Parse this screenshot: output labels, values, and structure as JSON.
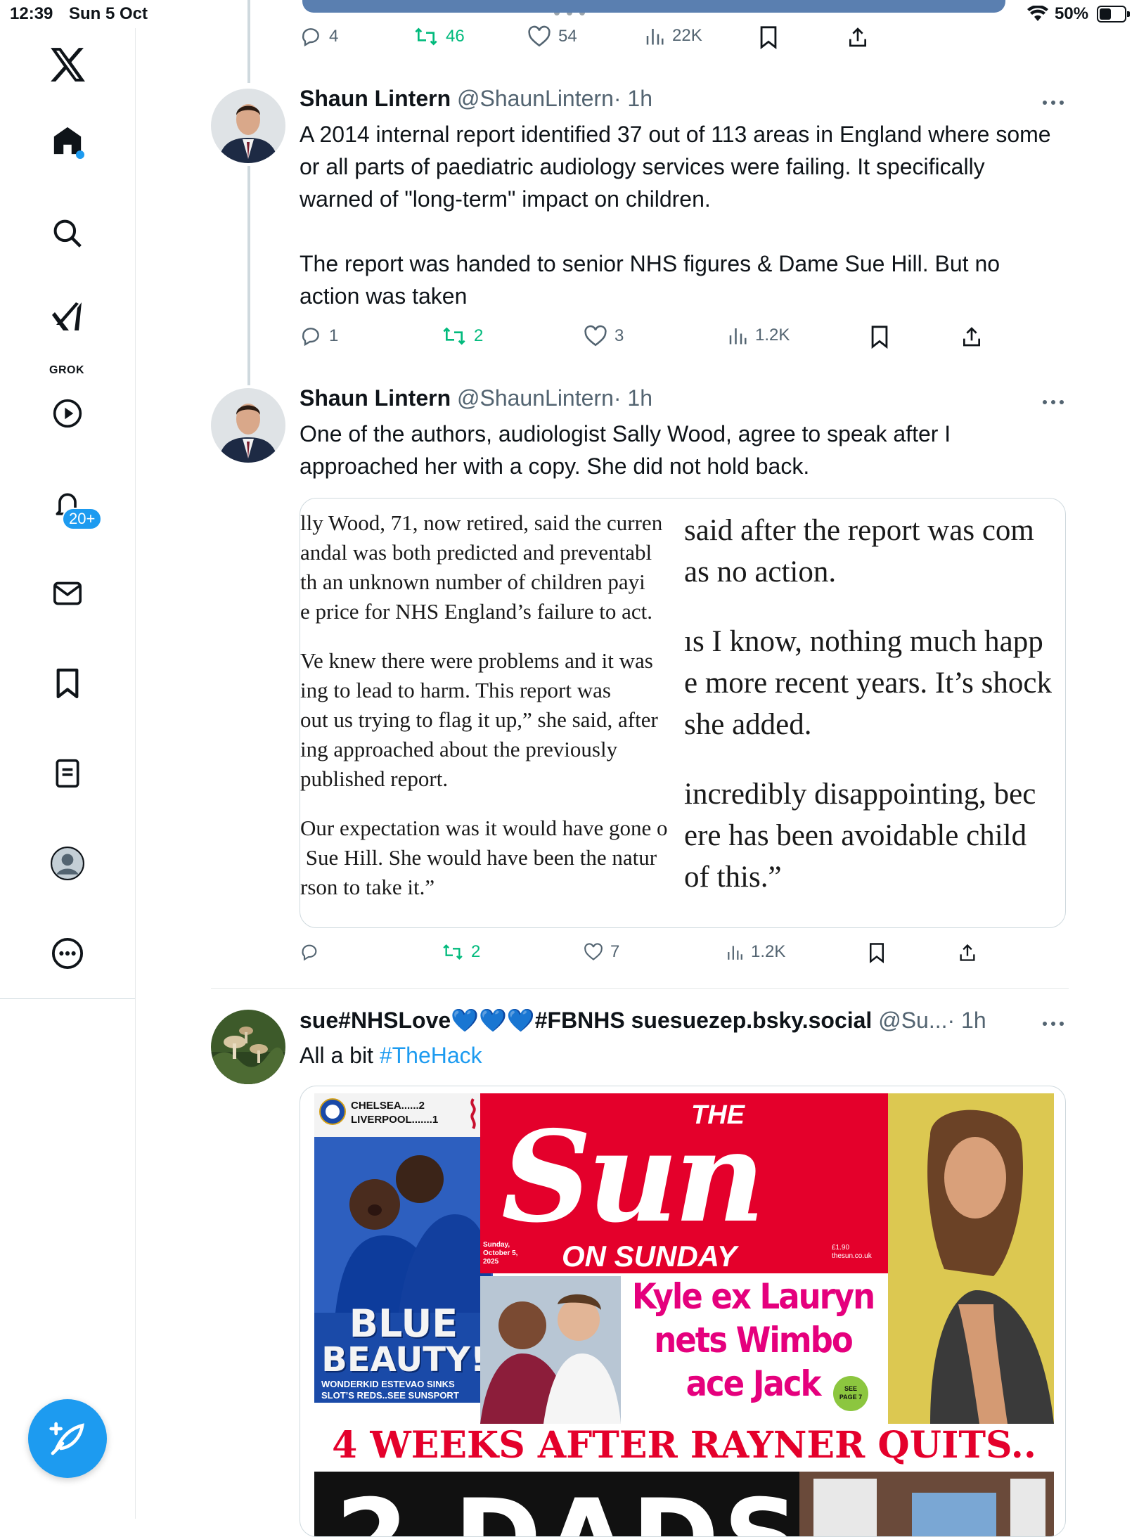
{
  "status_bar": {
    "time": "12:39",
    "date": "Sun 5 Oct",
    "battery": "50%",
    "battery_level": 0.5
  },
  "sidebar": {
    "grok_label": "GROK",
    "notifications_badge": "20+"
  },
  "top_tweet_actions": {
    "replies": "4",
    "retweets": "46",
    "likes": "54",
    "views": "22K"
  },
  "tweets": [
    {
      "name": "Shaun Lintern",
      "handle": "@ShaunLintern",
      "time": "· 1h",
      "text": "A 2014 internal report identified 37 out of 113 areas in England where some or all parts of paediatric audiology services were failing. It specifically warned of \"long-term\" impact on children.\n\nThe report was handed to senior NHS figures & Dame Sue Hill. But no action was taken",
      "replies": "1",
      "retweets": "2",
      "likes": "3",
      "views": "1.2K"
    },
    {
      "name": "Shaun Lintern",
      "handle": "@ShaunLintern",
      "time": "· 1h",
      "text": "One of the authors, audiologist Sally Wood, agree to speak after I approached her with a copy. She did not hold back.",
      "article_left": [
        "lly Wood, 71, now retired, said the curren\nandal was both predicted and preventabl\nth an unknown number of children payi\ne price for NHS England’s failure to act.",
        "Ve knew there were problems and it was\ning to lead to harm. This report was\nout us trying to flag it up,” she said, after\ning approached about the previously\npublished report.",
        "Our expectation was it would have gone o\n Sue Hill. She would have been the natur\nrson to take it.”"
      ],
      "article_right": [
        "said after the report was com\nas no action.",
        "ıs I know, nothing much happ\ne more recent years. It’s shock\nshe added.",
        "incredibly disappointing, bec\nere has been avoidable child\nof this.”"
      ],
      "replies": "",
      "retweets": "2",
      "likes": "7",
      "views": "1.2K"
    },
    {
      "name": "sue#NHSLove💙💙💙#FBNHS suesuezep.bsky.social",
      "handle": "@Su...",
      "time": "· 1h",
      "text_prefix": "All a bit ",
      "hashtag": "#TheHack"
    }
  ],
  "newspaper": {
    "score_home": "CHELSEA......2",
    "score_away": "LIVERPOOL.......1",
    "left_headline_1": "BLUE",
    "left_headline_2": "BEAUTY!",
    "left_sub": "WONDERKID ESTEVAO SINKS\nSLOT’S REDS..SEE SUNSPORT",
    "masthead_the": "THE",
    "masthead_sun": "Sun",
    "masthead_on_sunday": "ON SUNDAY",
    "date": "Sunday,\nOctober 5,\n2025",
    "price": "£1.90\nthesun.co.uk",
    "story_headline": "Kyle ex Lauryn\nnets Wimbo\nace Jack",
    "see_page": "SEE\nPAGE 7",
    "banner": "4 WEEKS AFTER RAYNER QUITS..",
    "big_headline_partial": "2 DADS"
  },
  "colors": {
    "accent": "#1d9bf0",
    "retweet": "#00ba7c",
    "sun_red": "#e4002b",
    "chelsea_blue": "#1a4aa8"
  }
}
